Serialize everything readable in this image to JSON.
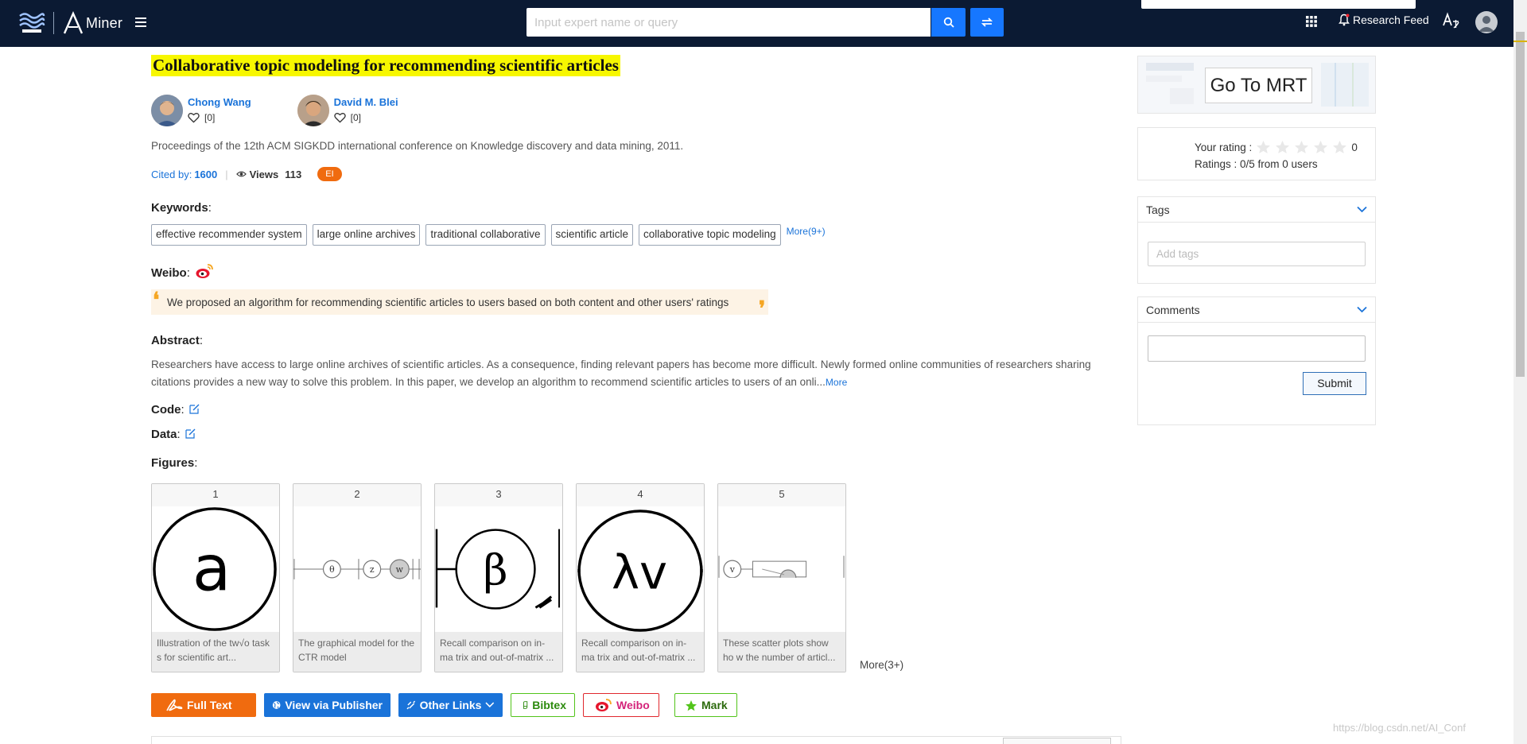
{
  "nav": {
    "brand_text": "Miner",
    "search_placeholder": "Input expert name or query",
    "research_feed": "Research Feed"
  },
  "paper": {
    "title": "Collaborative topic modeling for recommending scientific articles",
    "authors": [
      {
        "name": "Chong Wang",
        "follow_count": "[0]"
      },
      {
        "name": "David M. Blei",
        "follow_count": "[0]"
      }
    ],
    "venue": "Proceedings of the 12th ACM SIGKDD international conference on Knowledge discovery and data mining, 2011.",
    "cited_label": "Cited by:",
    "cited_count": "1600",
    "views_label": "Views",
    "views_count": "113",
    "badge": "EI"
  },
  "keywords": {
    "heading": "Keywords",
    "items": [
      "effective recommender system",
      "large online archives",
      "traditional collaborative",
      "scientific article",
      "collaborative topic modeling"
    ],
    "more": "More(9+)"
  },
  "weibo": {
    "heading": "Weibo",
    "quote": "We proposed an algorithm for recommending scientific articles to users based on both content and other users' ratings"
  },
  "abstract": {
    "heading": "Abstract",
    "text": "Researchers have access to large online archives of scientific articles. As a consequence, finding relevant papers has become more difficult. Newly formed online communities of researchers sharing citations provides a new way to solve this problem. In this paper, we develop an algorithm to recommend scientific articles to users of an onli...",
    "more": "More"
  },
  "code": {
    "heading": "Code"
  },
  "data_section": {
    "heading": "Data"
  },
  "figures": {
    "heading": "Figures",
    "items": [
      {
        "num": "1",
        "symbol": "a",
        "caption": "Illustration of the tw√o task s for scientific art..."
      },
      {
        "num": "2",
        "symbol": "",
        "caption": "The graphical model for the CTR model"
      },
      {
        "num": "3",
        "symbol": "β",
        "caption": "Recall comparison on in-ma trix and out-of-matrix ..."
      },
      {
        "num": "4",
        "symbol": "λv",
        "caption": "Recall comparison on in-ma trix and out-of-matrix ..."
      },
      {
        "num": "5",
        "symbol": "",
        "caption": "These scatter plots show ho w the number of articl..."
      }
    ],
    "more": "More(3+)"
  },
  "actions": {
    "full_text": "Full Text",
    "publisher": "View via Publisher",
    "other_links": "Other Links",
    "bibtex": "Bibtex",
    "weibo": "Weibo",
    "mark": "Mark"
  },
  "sidebar": {
    "mrt": "Go To MRT",
    "your_rating": "Your rating :",
    "rating_value": "0",
    "ratings_summary": "Ratings : 0/5 from 0 users",
    "rating_stars": 0,
    "tags_title": "Tags",
    "tags_placeholder": "Add tags",
    "comments_title": "Comments",
    "submit": "Submit"
  },
  "watermark": "https://blog.csdn.net/AI_Conf",
  "colors": {
    "nav_bg": "#0b1a33",
    "link_blue": "#1a73d9",
    "title_highlight": "#f7f700",
    "full_text_orange": "#f06b0f"
  }
}
